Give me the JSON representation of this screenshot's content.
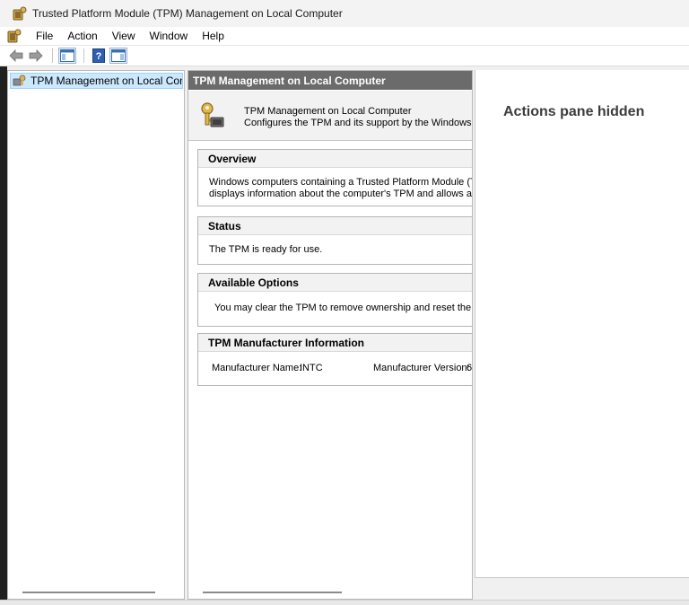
{
  "window": {
    "title": "Trusted Platform Module (TPM) Management on Local Computer"
  },
  "menu": {
    "items": [
      "File",
      "Action",
      "View",
      "Window",
      "Help"
    ]
  },
  "toolbar": {
    "icons": [
      "back-arrow-icon",
      "forward-arrow-icon",
      "show-hide-console-tree-icon",
      "help-icon",
      "show-hide-action-pane-icon"
    ]
  },
  "tree": {
    "selected_label": "TPM Management on Local Comp"
  },
  "center": {
    "header": "TPM Management on Local Computer",
    "intro_title": "TPM Management on Local Computer",
    "intro_desc": "Configures the TPM and its support by the Windows platfo",
    "overview": {
      "heading": "Overview",
      "line1": "Windows computers containing a Trusted Platform Module (TPM) p",
      "line2": "displays information about the computer's TPM and allows administ"
    },
    "status": {
      "heading": "Status",
      "text": "The TPM is ready for use."
    },
    "options": {
      "heading": "Available Options",
      "text": "You may clear the TPM to remove ownership and reset the TPM t"
    },
    "manufacturer": {
      "heading": "TPM Manufacturer Information",
      "name_label": "Manufacturer Name:",
      "name_value": "INTC",
      "version_label": "Manufacturer Version:",
      "version_value": "6"
    }
  },
  "actions": {
    "hidden_label": "Actions pane hidden"
  },
  "colors": {
    "header_bg": "#6b6b6b",
    "selection_bg": "#cce8ff",
    "selection_border": "#99d1ff"
  }
}
